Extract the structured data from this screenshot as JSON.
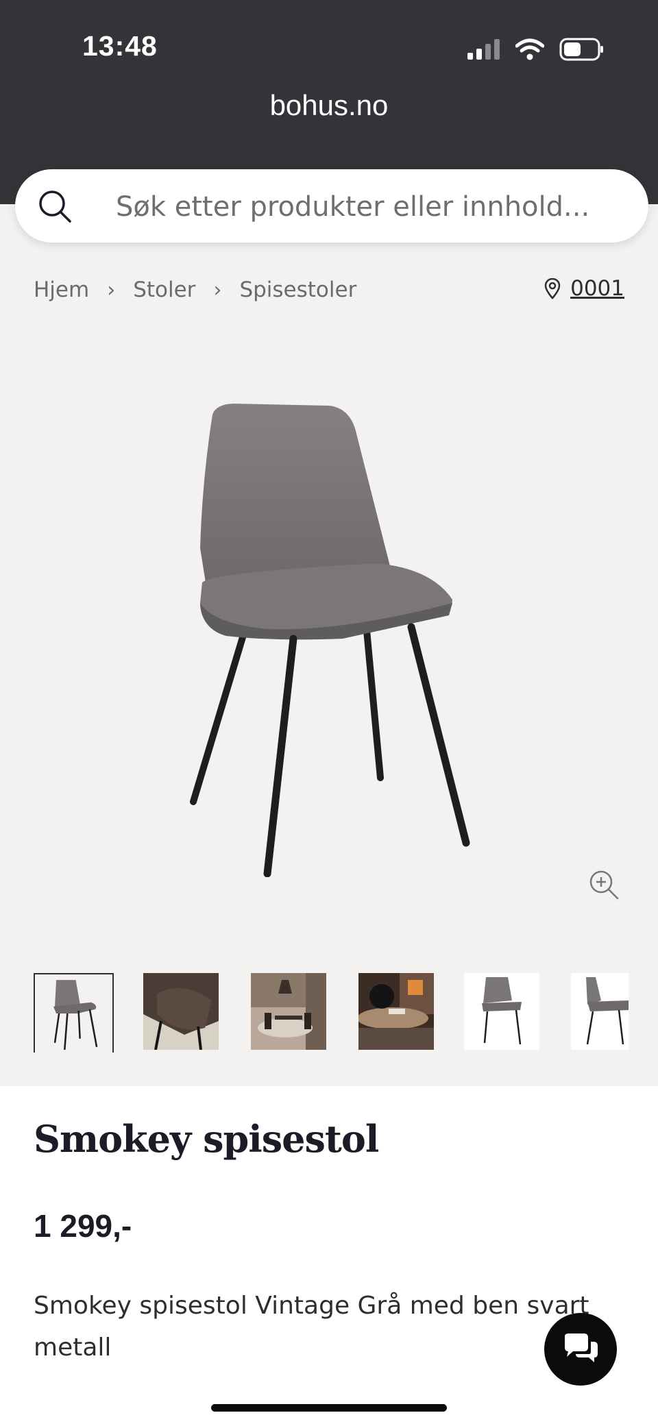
{
  "status_bar": {
    "time": "13:48",
    "url": "bohus.no"
  },
  "search": {
    "placeholder": "Søk etter produkter eller innhold..."
  },
  "breadcrumb": {
    "items": [
      "Hjem",
      "Stoler",
      "Spisestoler"
    ]
  },
  "store": {
    "code": "0001"
  },
  "product": {
    "title": "Smokey spisestol",
    "price": "1 299,-",
    "description": "Smokey spisestol Vintage Grå med ben svart metall"
  },
  "thumbnails": [
    {
      "name": "thumb-chair-front"
    },
    {
      "name": "thumb-chair-closeup"
    },
    {
      "name": "thumb-dining-room"
    },
    {
      "name": "thumb-table-setting"
    },
    {
      "name": "thumb-chair-front-2"
    },
    {
      "name": "thumb-chair-side"
    }
  ],
  "icons": {
    "search": "search-icon",
    "location": "location-pin-icon",
    "zoom": "zoom-in-icon",
    "chat": "chat-icon"
  },
  "colors": {
    "header_bg": "#333338",
    "page_bg": "#f4f2f1",
    "chair": "#7a7676"
  }
}
